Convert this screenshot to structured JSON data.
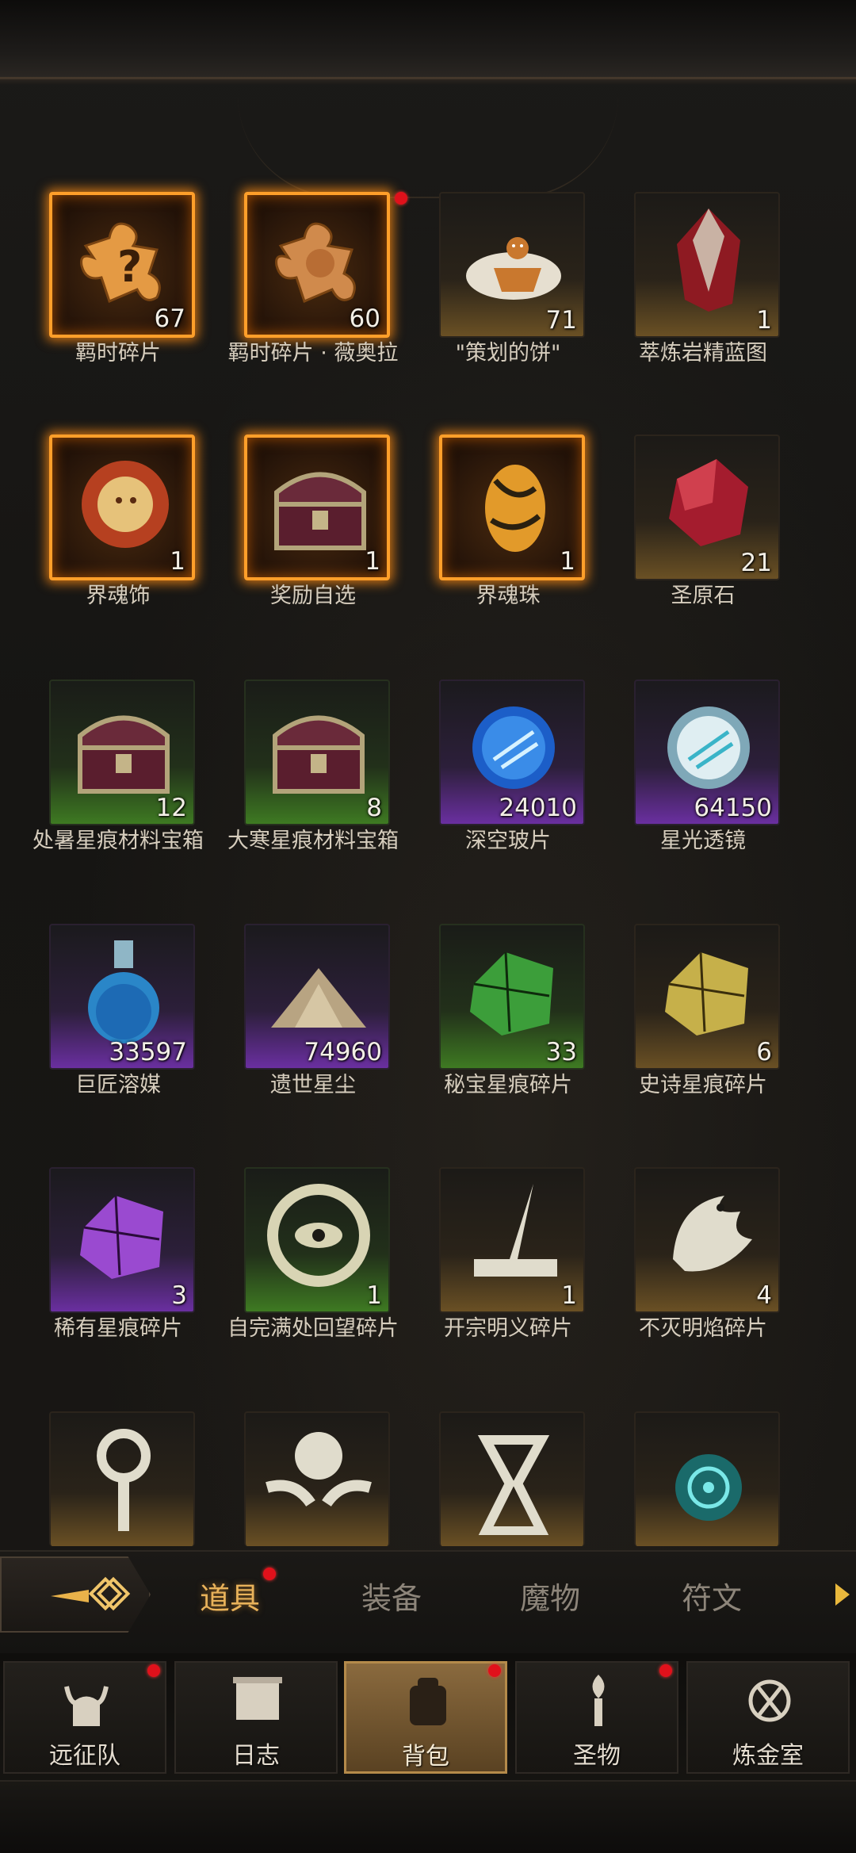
{
  "items": [
    {
      "name": "羁时碎片",
      "count": "67",
      "rarity": "orange",
      "icon": "puzzle-question-icon"
    },
    {
      "name": "羁时碎片 · 薇奥拉",
      "count": "60",
      "rarity": "orange",
      "icon": "puzzle-portrait-icon"
    },
    {
      "name": "\"策划的饼\"",
      "count": "71",
      "rarity": "gold",
      "icon": "gingerbread-icon"
    },
    {
      "name": "萃炼岩精蓝图",
      "count": "1",
      "rarity": "gold",
      "icon": "red-crystal-icon"
    },
    {
      "name": "界魂饰",
      "count": "1",
      "rarity": "orange",
      "icon": "sun-medallion-icon"
    },
    {
      "name": "奖励自选",
      "count": "1",
      "rarity": "orange",
      "icon": "treasure-chest-icon"
    },
    {
      "name": "界魂珠",
      "count": "1",
      "rarity": "orange",
      "icon": "amber-egg-icon"
    },
    {
      "name": "圣原石",
      "count": "21",
      "rarity": "gold",
      "icon": "ruby-stone-icon"
    },
    {
      "name": "处暑星痕材料宝箱",
      "count": "12",
      "rarity": "green",
      "icon": "treasure-chest-icon"
    },
    {
      "name": "大寒星痕材料宝箱",
      "count": "8",
      "rarity": "green",
      "icon": "treasure-chest-icon"
    },
    {
      "name": "深空玻片",
      "count": "24010",
      "rarity": "purple",
      "icon": "blue-orb-icon"
    },
    {
      "name": "星光透镜",
      "count": "64150",
      "rarity": "purple",
      "icon": "white-orb-icon"
    },
    {
      "name": "巨匠溶媒",
      "count": "33597",
      "rarity": "purple",
      "icon": "potion-flask-icon"
    },
    {
      "name": "遗世星尘",
      "count": "74960",
      "rarity": "purple",
      "icon": "dust-pile-icon"
    },
    {
      "name": "秘宝星痕碎片",
      "count": "33",
      "rarity": "green",
      "icon": "green-shard-icon"
    },
    {
      "name": "史诗星痕碎片",
      "count": "6",
      "rarity": "gold",
      "icon": "yellow-shard-icon"
    },
    {
      "name": "稀有星痕碎片",
      "count": "3",
      "rarity": "purple",
      "icon": "purple-shard-icon"
    },
    {
      "name": "自完满处回望碎片",
      "count": "1",
      "rarity": "green",
      "icon": "eye-rune-icon"
    },
    {
      "name": "开宗明义碎片",
      "count": "1",
      "rarity": "gold",
      "icon": "quill-rune-icon"
    },
    {
      "name": "不灭明焰碎片",
      "count": "4",
      "rarity": "gold",
      "icon": "phoenix-rune-icon"
    },
    {
      "name": "",
      "count": "",
      "rarity": "gold",
      "icon": "key-rune-icon"
    },
    {
      "name": "",
      "count": "",
      "rarity": "gold",
      "icon": "winged-rune-icon"
    },
    {
      "name": "",
      "count": "",
      "rarity": "gold",
      "icon": "hourglass-rune-icon"
    },
    {
      "name": "",
      "count": "",
      "rarity": "gold",
      "icon": "teal-circuit-icon"
    }
  ],
  "tabs": [
    {
      "label": "道具",
      "active": true,
      "dot": true
    },
    {
      "label": "装备",
      "active": false,
      "dot": false
    },
    {
      "label": "魔物",
      "active": false,
      "dot": false
    },
    {
      "label": "符文",
      "active": false,
      "dot": false
    }
  ],
  "nav": [
    {
      "label": "远征队",
      "icon": "horned-helmet-icon",
      "active": false,
      "dot": true
    },
    {
      "label": "日志",
      "icon": "scroll-icon",
      "active": false,
      "dot": false
    },
    {
      "label": "背包",
      "icon": "backpack-icon",
      "active": true,
      "dot": true
    },
    {
      "label": "圣物",
      "icon": "torch-icon",
      "active": false,
      "dot": true
    },
    {
      "label": "炼金室",
      "icon": "alchemy-icon",
      "active": false,
      "dot": false
    }
  ],
  "colors": {
    "orange_border": "#ff9f2a",
    "active_tab": "#e8b25a",
    "notification": "#e0111b"
  }
}
